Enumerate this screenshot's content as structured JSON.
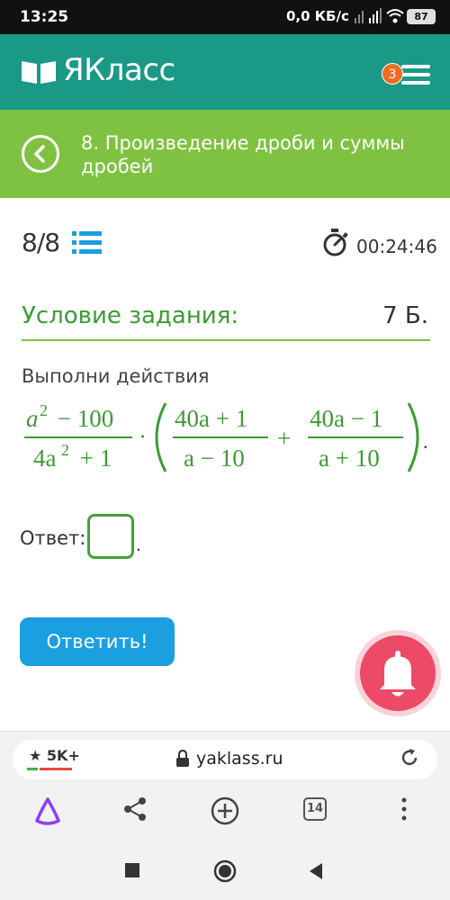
{
  "status_bar": {
    "time": "13:25",
    "network_speed": "0,0 КБ/с",
    "battery_level": "87"
  },
  "app": {
    "logo_text": "ЯКласс",
    "notification_count": "3",
    "brand_color": "#1a9a86"
  },
  "lesson": {
    "title": "8. Произведение дроби и суммы дробей",
    "header_color": "#7fc241"
  },
  "task": {
    "progress": "8/8",
    "timer": "00:24:46",
    "condition_label": "Условие задания:",
    "points": "7 Б.",
    "instruction": "Выполни действия",
    "formula": {
      "frac1_num_base": "a",
      "frac1_num_exp": "2",
      "frac1_num_rest": " − 100",
      "frac1_den_coef": "4a",
      "frac1_den_exp": "2",
      "frac1_den_rest": " + 1",
      "dot": "·",
      "frac2_num": "40a + 1",
      "frac2_den": "a − 10",
      "plus": "+",
      "frac3_num": "40a − 1",
      "frac3_den": "a + 10",
      "end": "."
    },
    "answer_label": "Ответ:",
    "answer_value": "",
    "answer_suffix": ".",
    "submit_label": "Ответить!"
  },
  "browser": {
    "rating": "★ 5K+",
    "domain": "yaklass.ru",
    "tab_count": "14"
  },
  "icons": {
    "back": "chevron-left-icon",
    "menu": "hamburger-icon",
    "list": "list-icon",
    "timer": "stopwatch-icon",
    "bell": "bell-icon",
    "lock": "lock-icon",
    "reload": "reload-icon",
    "share": "share-icon",
    "add": "plus-circle-icon"
  }
}
